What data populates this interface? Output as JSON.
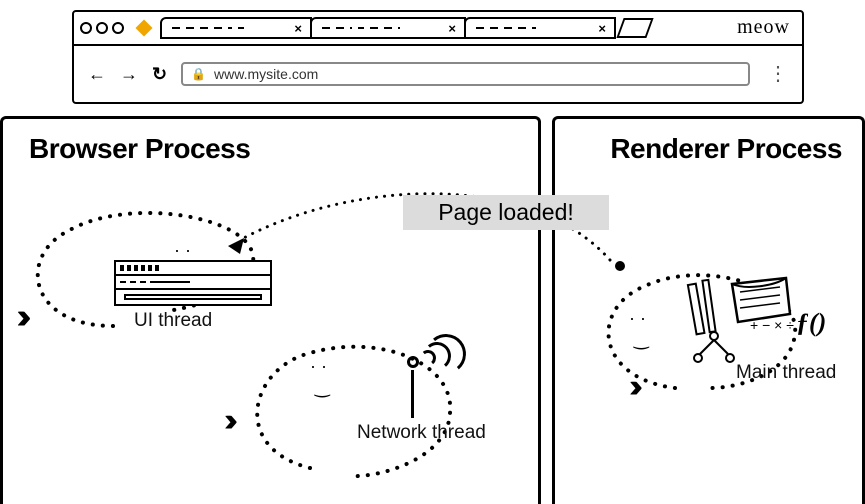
{
  "browser": {
    "brand": "meow",
    "url": "www.mysite.com",
    "tabs": [
      {
        "close": "×"
      },
      {
        "close": "×"
      },
      {
        "close": "×"
      }
    ],
    "nav": {
      "back": "←",
      "fwd": "→",
      "reload": "↻",
      "menu": "⋮"
    }
  },
  "panels": {
    "left_title": "Browser Process",
    "right_title": "Renderer Process"
  },
  "threads": {
    "ui": "UI thread",
    "network": "Network thread",
    "main": "Main thread"
  },
  "callout": "Page loaded!",
  "math": {
    "fn": "ƒ()",
    "ops": "+ −\n× ÷"
  },
  "ipc": {
    "from": "Main thread (Renderer Process)",
    "to": "UI thread (Browser Process)",
    "message": "Page loaded!",
    "direction": "renderer→browser"
  }
}
